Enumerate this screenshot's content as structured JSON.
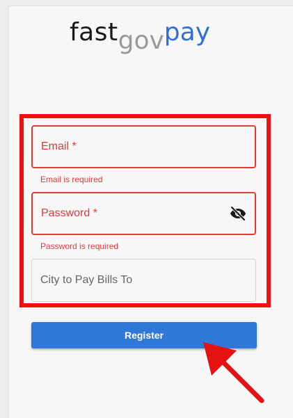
{
  "logo": {
    "part1": "fast",
    "part2": "gov",
    "part3": "pay"
  },
  "form": {
    "email": {
      "label": "Email *",
      "helper": "Email is required"
    },
    "password": {
      "label": "Password *",
      "helper": "Password is required",
      "toggle_icon": "eye-off-icon"
    },
    "city": {
      "label": "City to Pay Bills To"
    },
    "register_label": "Register"
  },
  "colors": {
    "error": "#e53935",
    "primary": "#2f78d9",
    "highlight": "#ee1111",
    "logo_gov": "#9a9a9a",
    "logo_pay": "#2f6fd6"
  }
}
